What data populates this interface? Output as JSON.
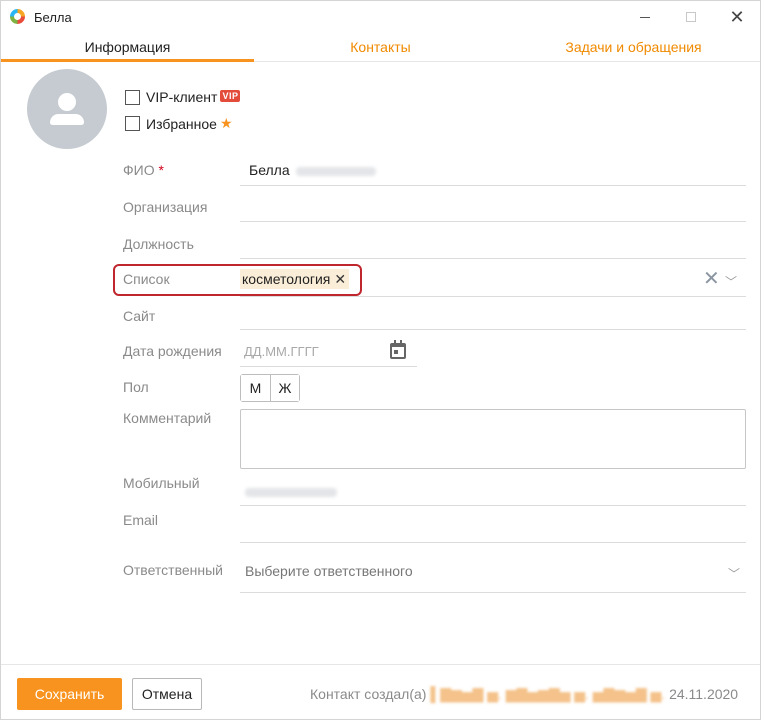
{
  "window": {
    "title": "Белла"
  },
  "tabs": [
    {
      "label": "Информация",
      "active": true
    },
    {
      "label": "Контакты",
      "active": false
    },
    {
      "label": "Задачи и обращения",
      "active": false
    }
  ],
  "flags": {
    "vip_label": "VIP-клиент",
    "vip_badge": "VIP",
    "favorite_label": "Избранное",
    "vip_checked": false,
    "favorite_checked": false
  },
  "fields": {
    "fio": {
      "label": "ФИО",
      "required_mark": "*",
      "value": "Белла"
    },
    "organization": {
      "label": "Организация",
      "value": ""
    },
    "position": {
      "label": "Должность",
      "value": ""
    },
    "list": {
      "label": "Список",
      "tags": [
        "косметология"
      ]
    },
    "site": {
      "label": "Сайт",
      "value": ""
    },
    "birthdate": {
      "label": "Дата рождения",
      "placeholder": "ДД.ММ.ГГГГ"
    },
    "gender": {
      "label": "Пол",
      "options": [
        "М",
        "Ж"
      ]
    },
    "comment": {
      "label": "Комментарий",
      "value": ""
    },
    "mobile": {
      "label": "Мобильный"
    },
    "email": {
      "label": "Email",
      "value": ""
    },
    "responsible": {
      "label": "Ответственный",
      "placeholder": "Выберите ответственного"
    }
  },
  "footer": {
    "save_label": "Сохранить",
    "cancel_label": "Отмена",
    "created_prefix": "Контакт создал(а)",
    "created_date": "24.11.2020"
  },
  "colors": {
    "accent": "#f7931e",
    "highlight": "#c0262d",
    "vip_badge": "#e34b3b",
    "chip_bg": "#fbeed8"
  }
}
